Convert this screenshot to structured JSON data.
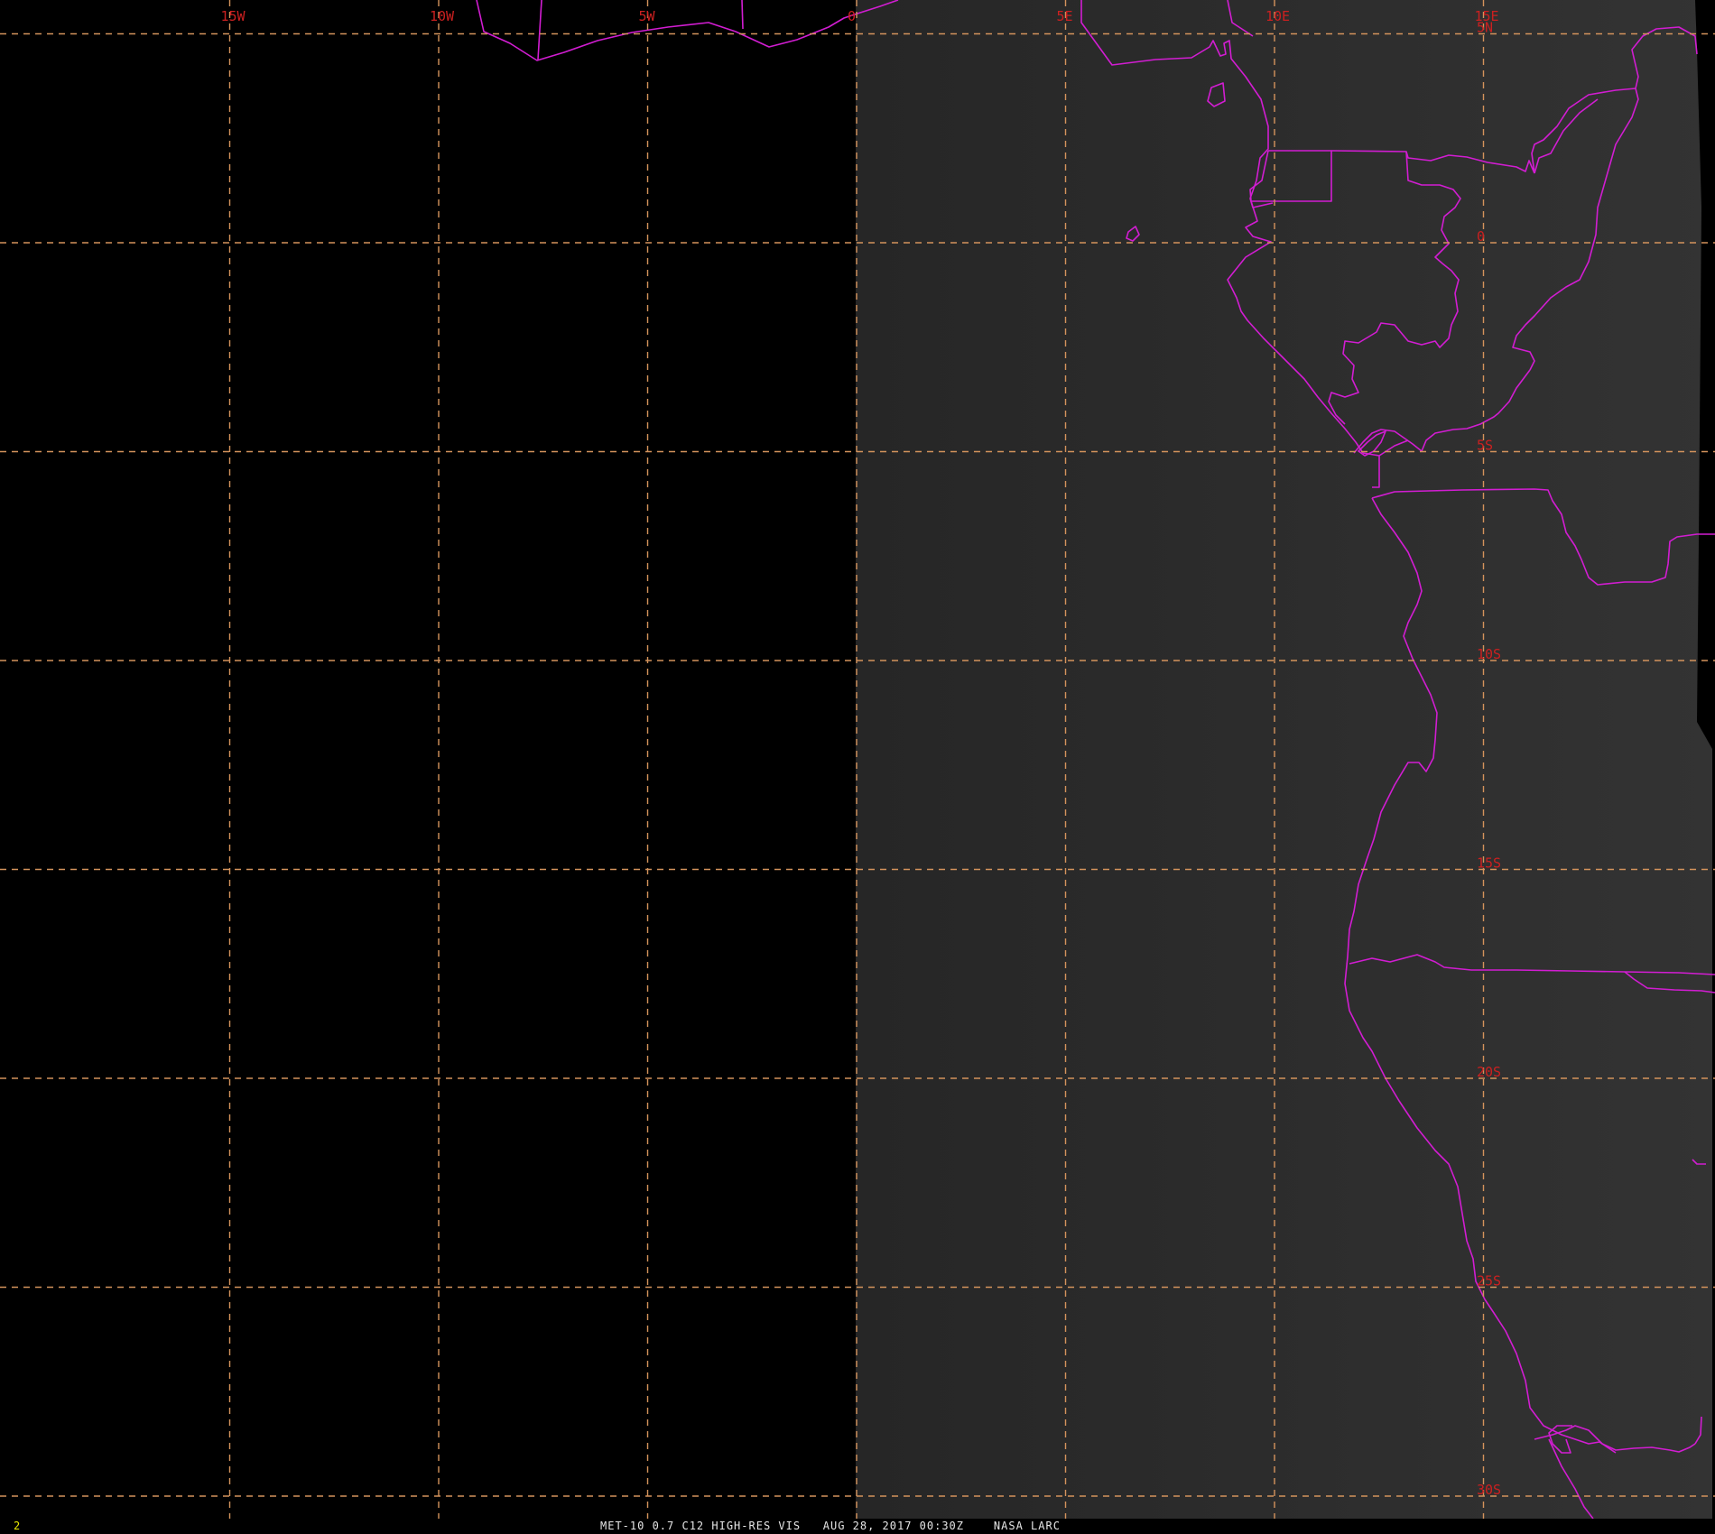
{
  "map": {
    "grid_color": "#d4935c",
    "label_color": "#cc2020",
    "border_color": "#d21dd2",
    "daylight_shade": "#2e2e2e",
    "night_shade": "#000000",
    "longitudes": [
      {
        "label": "15W",
        "value": -15
      },
      {
        "label": "10W",
        "value": -10
      },
      {
        "label": "5W",
        "value": -5
      },
      {
        "label": "0",
        "value": 0
      },
      {
        "label": "5E",
        "value": 5
      },
      {
        "label": "10E",
        "value": 10
      },
      {
        "label": "15E",
        "value": 15
      }
    ],
    "latitudes": [
      {
        "label": "5N",
        "value": 5
      },
      {
        "label": "0",
        "value": 0
      },
      {
        "label": "5S",
        "value": -5
      },
      {
        "label": "10S",
        "value": -10
      },
      {
        "label": "15S",
        "value": -15
      },
      {
        "label": "20S",
        "value": -20
      },
      {
        "label": "25S",
        "value": -25
      },
      {
        "label": "30S",
        "value": -30
      }
    ]
  },
  "status": {
    "frame_number": "2",
    "caption": "MET-10 0.7 C12 HIGH-RES VIS   AUG 28, 2017 00:30Z    NASA LARC"
  }
}
